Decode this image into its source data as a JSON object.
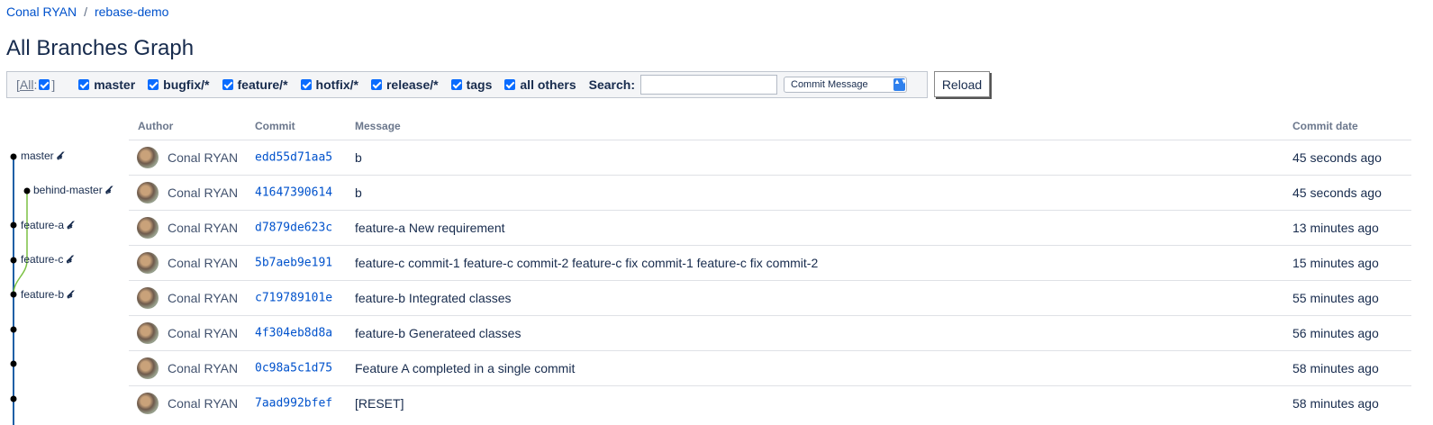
{
  "breadcrumb": {
    "owner": "Conal RYAN",
    "separator": "/",
    "repo": "rebase-demo"
  },
  "page_title": "All Branches Graph",
  "filters": {
    "all_prefix": "[",
    "all_label": "All",
    "all_colon": ":",
    "all_suffix": "]",
    "items": [
      "master",
      "bugfix/*",
      "feature/*",
      "hotfix/*",
      "release/*",
      "tags",
      "all others"
    ],
    "search_label": "Search:",
    "search_value": "",
    "search_mode": "Commit Message",
    "select_arrow": "▲▼",
    "reload_label": "Reload"
  },
  "table": {
    "headers": {
      "author": "Author",
      "commit": "Commit",
      "message": "Message",
      "date": "Commit date"
    },
    "rows": [
      {
        "author": "Conal RYAN",
        "hash": "edd55d71aa5",
        "message": "b",
        "date": "45 seconds ago"
      },
      {
        "author": "Conal RYAN",
        "hash": "41647390614",
        "message": "b",
        "date": "45 seconds ago"
      },
      {
        "author": "Conal RYAN",
        "hash": "d7879de623c",
        "message": "feature-a New requirement",
        "date": "13 minutes ago"
      },
      {
        "author": "Conal RYAN",
        "hash": "5b7aeb9e191",
        "message": "feature-c commit-1 feature-c commit-2 feature-c fix commit-1 feature-c fix commit-2",
        "date": "15 minutes ago"
      },
      {
        "author": "Conal RYAN",
        "hash": "c719789101e",
        "message": "feature-b Integrated classes",
        "date": "55 minutes ago"
      },
      {
        "author": "Conal RYAN",
        "hash": "4f304eb8d8a",
        "message": "feature-b Generateed classes",
        "date": "56 minutes ago"
      },
      {
        "author": "Conal RYAN",
        "hash": "0c98a5c1d75",
        "message": "Feature A completed in a single commit",
        "date": "58 minutes ago"
      },
      {
        "author": "Conal RYAN",
        "hash": "7aad992bfef",
        "message": "[RESET]",
        "date": "58 minutes ago"
      }
    ]
  },
  "graph": {
    "branch_labels": [
      "master",
      "behind-master",
      "feature-a",
      "feature-c",
      "feature-b"
    ],
    "branch_icon": "𝓫",
    "colors": {
      "main_line": "#1f5fa6",
      "branch_line": "#7bc142",
      "node": "#000000"
    }
  }
}
